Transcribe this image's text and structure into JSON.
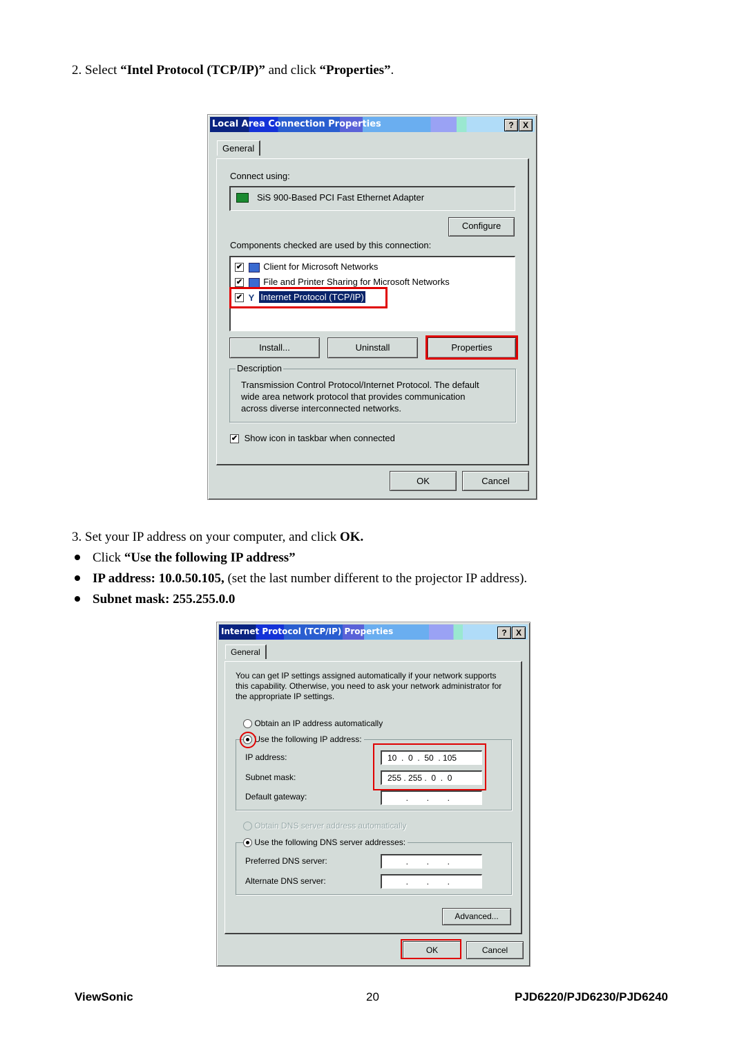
{
  "step2": {
    "prefix": "2. Select ",
    "item": "“Intel Protocol (TCP/IP)”",
    "middle": " and click ",
    "button": "“Properties”",
    "suffix": "."
  },
  "dialog1": {
    "title": "Local Area Connection Properties",
    "help_btn": "?",
    "close_btn": "X",
    "tab": "General",
    "connect_using_label": "Connect using:",
    "adapter": "SiS 900-Based PCI Fast Ethernet Adapter",
    "configure_btn": "Configure",
    "components_label": "Components checked are used by this connection:",
    "components": [
      {
        "label": "Client for Microsoft Networks",
        "checked": true,
        "icon": "computer-icon"
      },
      {
        "label": "File and Printer Sharing for Microsoft Networks",
        "checked": true,
        "icon": "computer-share-icon"
      },
      {
        "label": "Internet Protocol (TCP/IP)",
        "checked": true,
        "icon": "network-protocol-icon",
        "selected": true
      }
    ],
    "install_btn": "Install...",
    "uninstall_btn": "Uninstall",
    "properties_btn": "Properties",
    "description_legend": "Description",
    "description_lines": [
      "Transmission Control Protocol/Internet Protocol. The default",
      "wide area network protocol that provides communication",
      "across diverse interconnected networks."
    ],
    "show_icon_label": "Show icon in taskbar when connected",
    "show_icon_checked": true,
    "ok_btn": "OK",
    "cancel_btn": "Cancel",
    "check_glyph": "✔"
  },
  "step3": {
    "prefix": "3. Set your IP address on your computer, and click ",
    "ok": "OK.",
    "bullets": [
      {
        "normal_pre": "Click ",
        "bold": "“Use the following IP address”",
        "normal_post": ""
      },
      {
        "normal_pre": "",
        "bold": "IP address: 10.0.50.105,",
        "normal_post": " (set the last number different to the projector IP address)."
      },
      {
        "normal_pre": "",
        "bold": "Subnet mask: 255.255.0.0",
        "normal_post": ""
      }
    ]
  },
  "dialog2": {
    "title": "Internet Protocol (TCP/IP) Properties",
    "help_btn": "?",
    "close_btn": "X",
    "tab": "General",
    "intro_lines": [
      "You can get IP settings assigned automatically if your network supports",
      "this capability. Otherwise, you need to ask your network administrator for",
      "the appropriate IP settings."
    ],
    "obtain_ip_auto": "Obtain an IP address automatically",
    "use_following_ip": "Use the following IP address:",
    "ip_mode_selected": "use_following",
    "ip_address_label": "IP address:",
    "ip_address_value": "10  .  0  .  50  . 105",
    "subnet_label": "Subnet mask:",
    "subnet_value": "255 . 255 .  0  .  0",
    "gateway_label": "Default gateway:",
    "gateway_value": "        .        .        .",
    "obtain_dns_auto": "Obtain DNS server address automatically",
    "use_following_dns": "Use the following DNS server addresses:",
    "dns_mode_selected": "use_following",
    "preferred_dns_label": "Preferred DNS server:",
    "preferred_dns_value": "        .        .        .",
    "alternate_dns_label": "Alternate DNS server:",
    "alternate_dns_value": "        .        .        .",
    "advanced_btn": "Advanced...",
    "ok_btn": "OK",
    "cancel_btn": "Cancel"
  },
  "footer": {
    "brand": "ViewSonic",
    "page_number": "20",
    "models": "PJD6220/PJD6230/PJD6240"
  },
  "colors": {
    "highlight_red": "#e00000",
    "selection_blue": "#0a246a",
    "dialog_gray": "#d4dcd9"
  }
}
